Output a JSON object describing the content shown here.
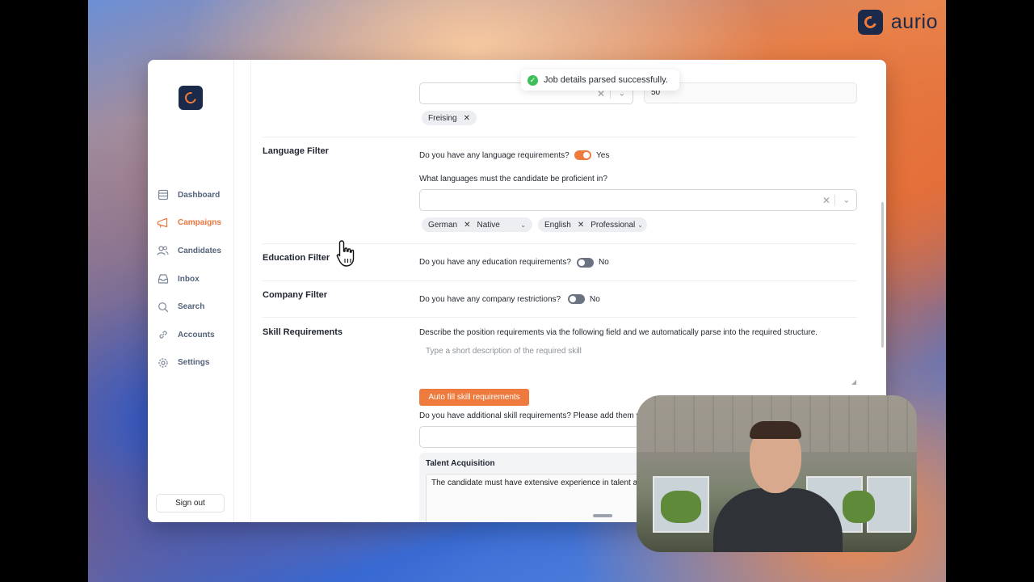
{
  "brand": {
    "name": "aurio"
  },
  "toast": {
    "message": "Job details parsed successfully."
  },
  "sidebar": {
    "items": [
      {
        "label": "Dashboard",
        "icon": "dashboard-icon"
      },
      {
        "label": "Campaigns",
        "icon": "megaphone-icon",
        "active": true
      },
      {
        "label": "Candidates",
        "icon": "users-icon"
      },
      {
        "label": "Inbox",
        "icon": "inbox-icon"
      },
      {
        "label": "Search",
        "icon": "search-icon"
      },
      {
        "label": "Accounts",
        "icon": "link-icon"
      },
      {
        "label": "Settings",
        "icon": "gear-icon"
      }
    ],
    "sign_out": "Sign out"
  },
  "location": {
    "radius_value": "50",
    "chips": [
      "Freising"
    ]
  },
  "language_filter": {
    "title": "Language Filter",
    "question": "Do you have any language requirements?",
    "toggle_label": "Yes",
    "toggle_on": true,
    "proficiency_question": "What languages must the candidate be proficient in?",
    "languages": [
      {
        "language": "German",
        "level": "Native"
      },
      {
        "language": "English",
        "level": "Professional"
      }
    ]
  },
  "education_filter": {
    "title": "Education Filter",
    "question": "Do you have any education requirements?",
    "toggle_label": "No",
    "toggle_on": false
  },
  "company_filter": {
    "title": "Company Filter",
    "question": "Do you have any company restrictions?",
    "toggle_label": "No",
    "toggle_on": false
  },
  "skill_requirements": {
    "title": "Skill Requirements",
    "description": "Describe the position requirements via the following field and we automatically parse into the required structure.",
    "placeholder": "Type a short description of the required skill",
    "autofill_button": "Auto fill skill requirements",
    "additional_question": "Do you have additional skill requirements? Please add them via",
    "card": {
      "title": "Talent Acquisition",
      "text": "The candidate must have extensive experience in talent ac"
    }
  },
  "colors": {
    "accent": "#ee7a3e",
    "brand_dark": "#1b2a4b",
    "success": "#3fbf5a"
  }
}
